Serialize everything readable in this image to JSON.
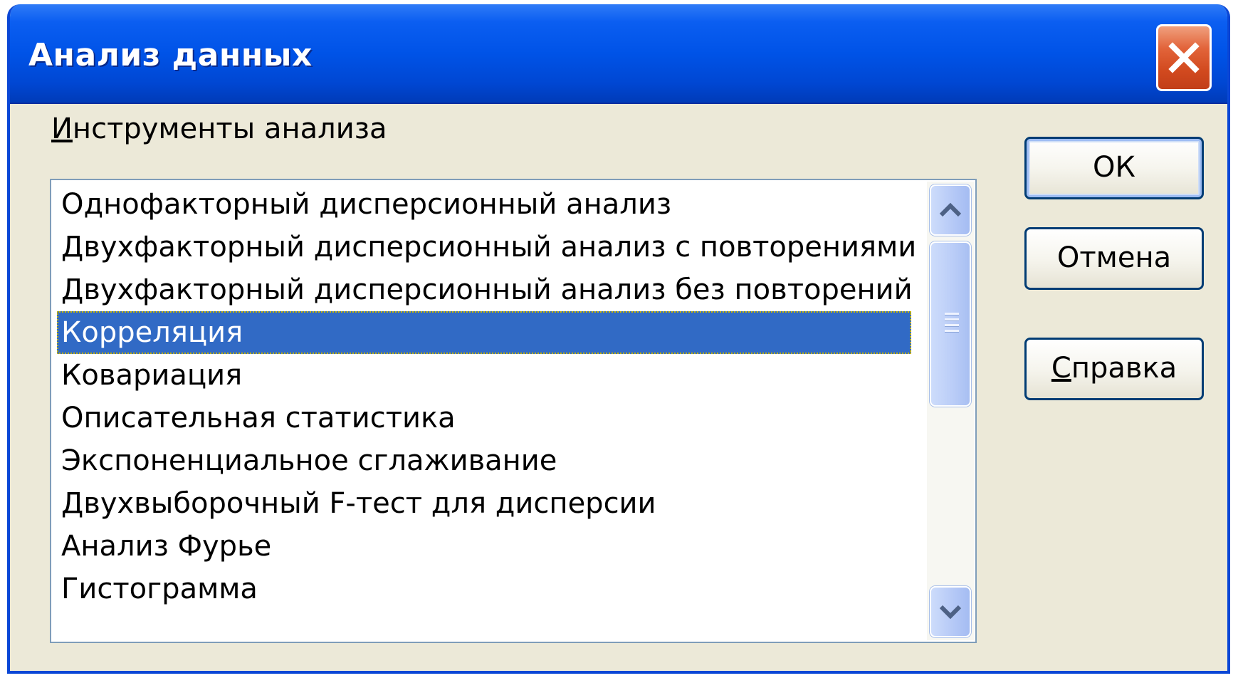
{
  "window": {
    "title": "Анализ данных"
  },
  "tools": {
    "label_first_letter": "И",
    "label_rest": "нструменты анализа",
    "items": [
      {
        "label": "Однофакторный дисперсионный анализ",
        "selected": false
      },
      {
        "label": "Двухфакторный дисперсионный анализ с повторениями",
        "selected": false
      },
      {
        "label": "Двухфакторный дисперсионный анализ без повторений",
        "selected": false
      },
      {
        "label": "Корреляция",
        "selected": true
      },
      {
        "label": "Ковариация",
        "selected": false
      },
      {
        "label": "Описательная статистика",
        "selected": false
      },
      {
        "label": "Экспоненциальное сглаживание",
        "selected": false
      },
      {
        "label": "Двухвыборочный F-тест для дисперсии",
        "selected": false
      },
      {
        "label": "Анализ Фурье",
        "selected": false
      },
      {
        "label": "Гистограмма",
        "selected": false
      }
    ]
  },
  "buttons": {
    "ok": "ОК",
    "cancel": "Отмена",
    "help_first_letter": "С",
    "help_rest": "правка"
  },
  "icons": {
    "close": "close-icon",
    "scroll_up": "chevron-up-icon",
    "scroll_down": "chevron-down-icon",
    "thumb_grip": "grip-icon"
  },
  "colors": {
    "title_bar": "#0053e7",
    "selection": "#316ac5",
    "dialog_bg": "#ece9d8",
    "close_button": "#d24a1f"
  }
}
